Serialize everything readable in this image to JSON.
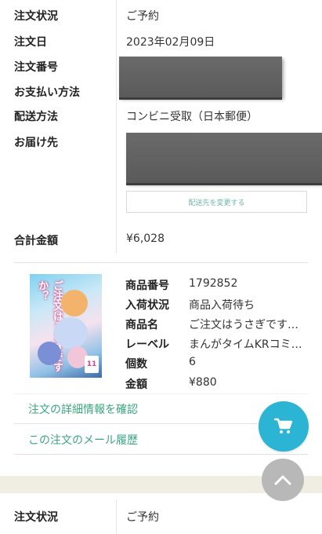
{
  "order": {
    "status_label": "注文状況",
    "status_value": "ご予約",
    "date_label": "注文日",
    "date_value": "2023年02月09日",
    "number_label": "注文番号",
    "payment_label": "お支払い方法",
    "shipping_label": "配送方法",
    "shipping_value": "コンビニ受取（日本郵便）",
    "address_label": "お届け先",
    "change_address_button": "配送先を変更する",
    "total_label": "合計金額",
    "total_value": "¥6,028"
  },
  "item": {
    "cover_title": "ご注文はうさぎですか？",
    "cover_volume": "11",
    "fields": [
      {
        "label": "商品番号",
        "value": "1792852"
      },
      {
        "label": "入荷状況",
        "value": "商品入荷待ち"
      },
      {
        "label": "商品名",
        "value": "ご注文はうさぎです…"
      },
      {
        "label": "レーベル",
        "value": "まんがタイムKRコミ…"
      },
      {
        "label": "個数",
        "value": "6"
      },
      {
        "label": "金額",
        "value": "¥880"
      }
    ]
  },
  "links": {
    "details": "注文の詳細情報を確認",
    "mail_history": "この注文のメール履歴"
  },
  "next_order": {
    "status_label": "注文状況",
    "status_value": "ご予約"
  },
  "colors": {
    "accent_green": "#3aa77f",
    "cart_button": "#2bb4d3",
    "scroll_top_button": "#b8b8b8",
    "band": "#f0eee3"
  },
  "icons": {
    "cart": "shopping-cart-icon",
    "scroll_top": "chevron-up-icon"
  }
}
